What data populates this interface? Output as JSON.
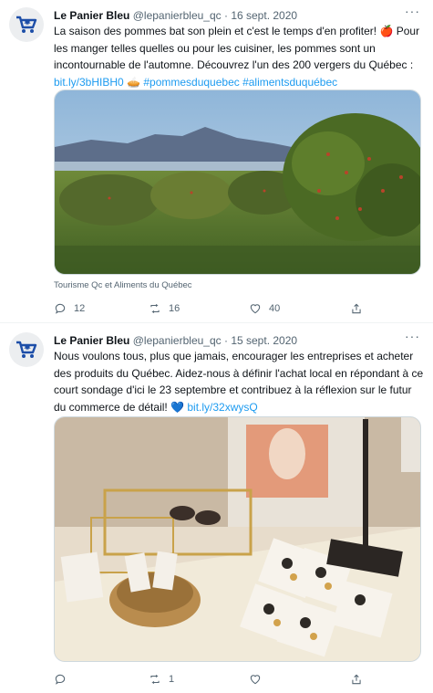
{
  "tweets": [
    {
      "author": "Le Panier Bleu",
      "handle": "@lepanierbleu_qc",
      "date": "16 sept. 2020",
      "text_before": "La saison des pommes bat son plein et c'est le temps d'en profiter! ",
      "emoji1": "🍎",
      "text_middle": " Pour les manger telles quelles ou pour les cuisiner, les pommes sont un incontournable de l'automne. Découvrez l'un des 200 vergers du Québec : ",
      "link": "bit.ly/3bHIBH0",
      "emoji2": "🥧",
      "hashtags": "#pommesduquebec #alimentsduquébec",
      "image_caption": "Tourisme Qc et Aliments du Québec",
      "replies": "12",
      "retweets": "16",
      "likes": "40"
    },
    {
      "author": "Le Panier Bleu",
      "handle": "@lepanierbleu_qc",
      "date": "15 sept. 2020",
      "text_before": "Nous voulons tous, plus que jamais, encourager les entreprises et acheter des produits du Québec. Aidez-nous à définir l'achat local en répondant à ce court sondage d'ici le 23 septembre et contribuez à la réflexion sur le futur du commerce de détail! ",
      "emoji1": "💙",
      "link": "bit.ly/32xwysQ",
      "replies": "",
      "retweets": "1",
      "likes": ""
    }
  ],
  "colors": {
    "brand": "#1d4ea8",
    "link": "#1d9bf0",
    "muted": "#536471"
  },
  "icons": [
    "shopping-cart-logo-icon",
    "more-icon",
    "reply-icon",
    "retweet-icon",
    "like-icon",
    "share-icon"
  ]
}
